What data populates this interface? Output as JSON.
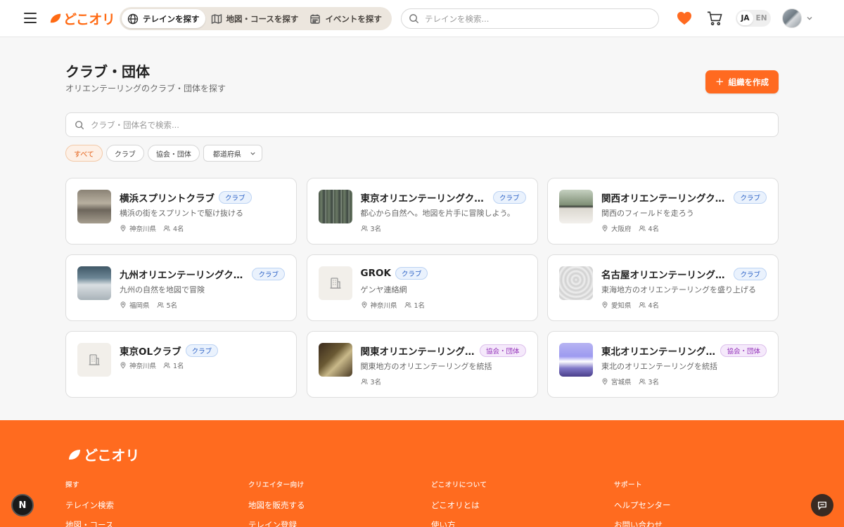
{
  "header": {
    "logo_text": "どこオリ",
    "nav_tabs": [
      {
        "label": "テレイン を探す",
        "icon": "globe-icon",
        "active": true
      },
      {
        "label": "地図・コースを探す",
        "icon": "map-icon",
        "active": false
      },
      {
        "label": "イベントを探す",
        "icon": "calendar-icon",
        "active": false
      }
    ],
    "search_placeholder": "テレインを検索...",
    "lang": {
      "ja": "JA",
      "en": "EN"
    }
  },
  "main": {
    "title": "クラブ・団体",
    "subtitle": "オリエンテーリングのクラブ・団体を探す",
    "create_button": "組織を作成",
    "search_placeholder": "クラブ・団体名で検索...",
    "filters": {
      "all": "すべて",
      "club": "クラブ",
      "assoc": "協会・団体",
      "prefecture": "都道府県"
    }
  },
  "clubs": [
    {
      "name": "横浜スプリントクラブ",
      "type": "クラブ",
      "kind": "club",
      "desc": "横浜の街をスプリントで駆け抜ける",
      "pref": "神奈川県",
      "members": "4名",
      "thumb": "street"
    },
    {
      "name": "東京オリエンテーリングク…",
      "type": "クラブ",
      "kind": "club",
      "desc": "都心から自然へ。地図を片手に冒険しよう。",
      "pref": "",
      "members": "3名",
      "thumb": "forest"
    },
    {
      "name": "関西オリエンテーリングク…",
      "type": "クラブ",
      "kind": "club",
      "desc": "関西のフィールドを走ろう",
      "pref": "大阪府",
      "members": "4名",
      "thumb": "balcony"
    },
    {
      "name": "九州オリエンテーリングク…",
      "type": "クラブ",
      "kind": "club",
      "desc": "九州の自然を地図で冒険",
      "pref": "福岡県",
      "members": "5名",
      "thumb": "snow"
    },
    {
      "name": "GROK",
      "type": "クラブ",
      "kind": "club",
      "desc": "ゲンヤ連絡網",
      "pref": "神奈川県",
      "members": "1名",
      "thumb": "placeholder"
    },
    {
      "name": "名古屋オリエンテーリング…",
      "type": "クラブ",
      "kind": "club",
      "desc": "東海地方のオリエンテーリングを盛り上げる",
      "pref": "愛知県",
      "members": "4名",
      "thumb": "dome"
    },
    {
      "name": "東京OLクラブ",
      "type": "クラブ",
      "kind": "club",
      "desc": "",
      "pref": "神奈川県",
      "members": "1名",
      "thumb": "placeholder"
    },
    {
      "name": "関東オリエンテーリング…",
      "type": "協会・団体",
      "kind": "assoc",
      "desc": "関東地方のオリエンテーリングを統括",
      "pref": "",
      "members": "3名",
      "thumb": "leaf"
    },
    {
      "name": "東北オリエンテーリング…",
      "type": "協会・団体",
      "kind": "assoc",
      "desc": "東北のオリエンテーリングを統括",
      "pref": "宮城県",
      "members": "3名",
      "thumb": "sky"
    }
  ],
  "footer": {
    "logo_text": "どこオリ",
    "columns": [
      {
        "title": "探す",
        "links": [
          "テレイン検索",
          "地図・コース"
        ]
      },
      {
        "title": "クリエイター向け",
        "links": [
          "地図を販売する",
          "テレイン登録"
        ]
      },
      {
        "title": "どこオリについて",
        "links": [
          "どこオリとは",
          "使い方"
        ]
      },
      {
        "title": "サポート",
        "links": [
          "ヘルプセンター",
          "お問い合わせ"
        ]
      }
    ]
  },
  "floating": {
    "n_label": "N"
  },
  "colors": {
    "accent": "#ff6a20",
    "footer": "#ff6b1f",
    "club_badge": "#2c62c6",
    "assoc_badge": "#9230b8"
  }
}
